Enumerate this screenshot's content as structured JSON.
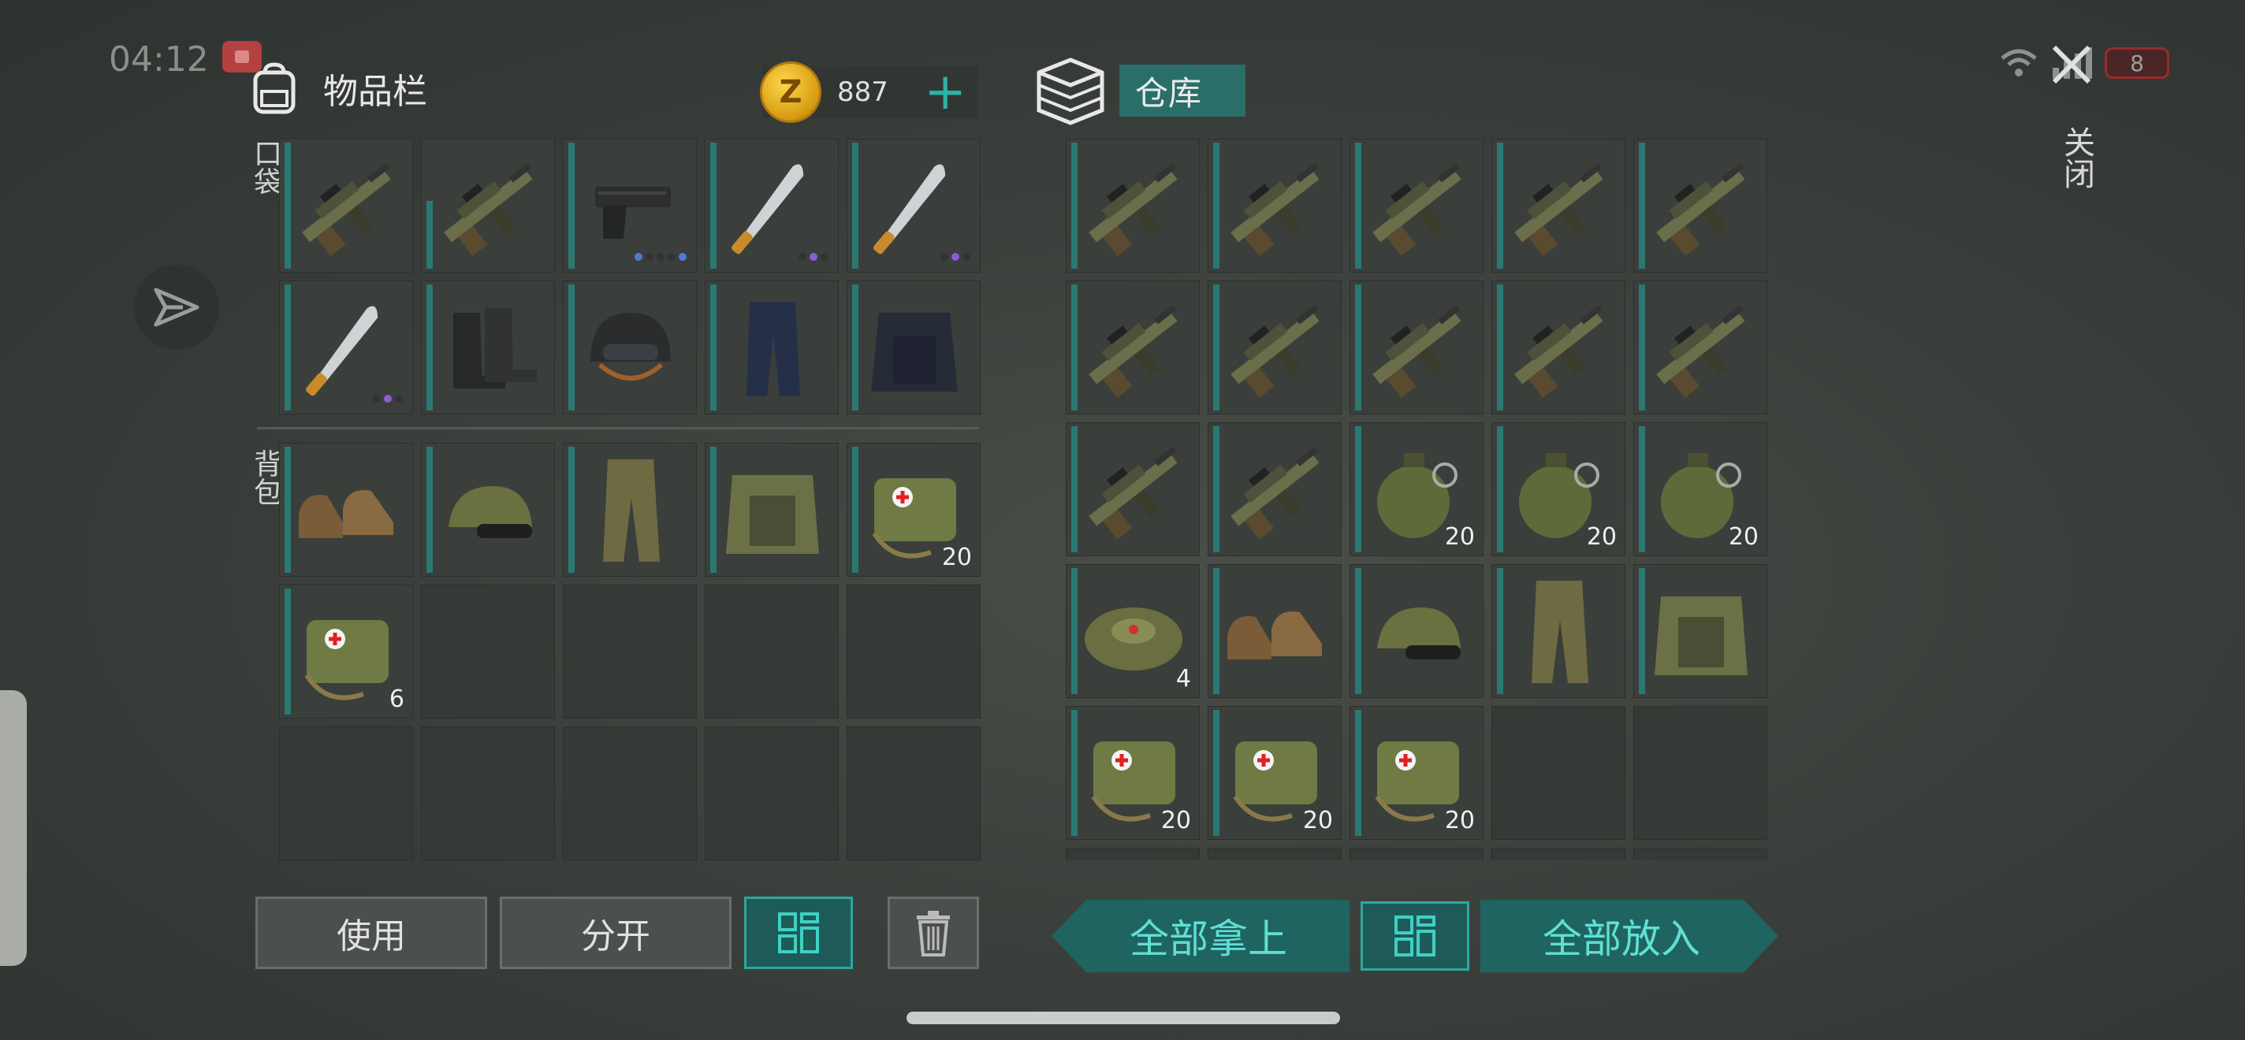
{
  "status": {
    "time": "04:12",
    "battery": "8"
  },
  "inventory": {
    "title": "物品栏",
    "coins": "887",
    "pockets_label": "口袋",
    "backpack_label": "背包",
    "pockets": [
      {
        "icon": "assault-rifle",
        "dur": "full"
      },
      {
        "icon": "assault-rifle",
        "dur": "low"
      },
      {
        "icon": "pistol",
        "dots": [
          "b",
          "d",
          "d",
          "d",
          "b"
        ]
      },
      {
        "icon": "machete",
        "dots": [
          "d",
          "p",
          "d"
        ]
      },
      {
        "icon": "machete",
        "dots": [
          "d",
          "p",
          "d"
        ]
      },
      {
        "icon": "machete",
        "dots": [
          "d",
          "p",
          "d"
        ]
      },
      {
        "icon": "boots-black"
      },
      {
        "icon": "helmet"
      },
      {
        "icon": "pants-blue"
      },
      {
        "icon": "vest-blue"
      }
    ],
    "backpack": [
      {
        "icon": "shoes-brown"
      },
      {
        "icon": "cap-camo"
      },
      {
        "icon": "pants-camo"
      },
      {
        "icon": "vest-camo"
      },
      {
        "icon": "medkit",
        "count": "20"
      },
      {
        "icon": "medkit",
        "count": "6"
      },
      {},
      {},
      {},
      {},
      {},
      {},
      {},
      {},
      {}
    ]
  },
  "warehouse": {
    "title": "仓库",
    "items": [
      {
        "icon": "assault-rifle"
      },
      {
        "icon": "assault-rifle"
      },
      {
        "icon": "assault-rifle"
      },
      {
        "icon": "assault-rifle"
      },
      {
        "icon": "assault-rifle"
      },
      {
        "icon": "assault-rifle"
      },
      {
        "icon": "assault-rifle"
      },
      {
        "icon": "assault-rifle"
      },
      {
        "icon": "assault-rifle"
      },
      {
        "icon": "assault-rifle"
      },
      {
        "icon": "assault-rifle"
      },
      {
        "icon": "assault-rifle"
      },
      {
        "icon": "grenade",
        "count": "20"
      },
      {
        "icon": "grenade",
        "count": "20"
      },
      {
        "icon": "grenade",
        "count": "20"
      },
      {
        "icon": "landmine",
        "count": "4"
      },
      {
        "icon": "shoes-brown"
      },
      {
        "icon": "cap-camo"
      },
      {
        "icon": "pants-camo"
      },
      {
        "icon": "vest-camo"
      },
      {
        "icon": "medkit",
        "count": "20"
      },
      {
        "icon": "medkit",
        "count": "20"
      },
      {
        "icon": "medkit",
        "count": "20"
      },
      {},
      {},
      {},
      {},
      {},
      {},
      {}
    ]
  },
  "buttons": {
    "use": "使用",
    "split": "分开",
    "take_all": "全部拿上",
    "put_all": "全部放入",
    "close": "关闭"
  },
  "colors": {
    "accent": "#2bb3a9",
    "slot_bar": "#2b7873",
    "panel": "#363a37"
  }
}
